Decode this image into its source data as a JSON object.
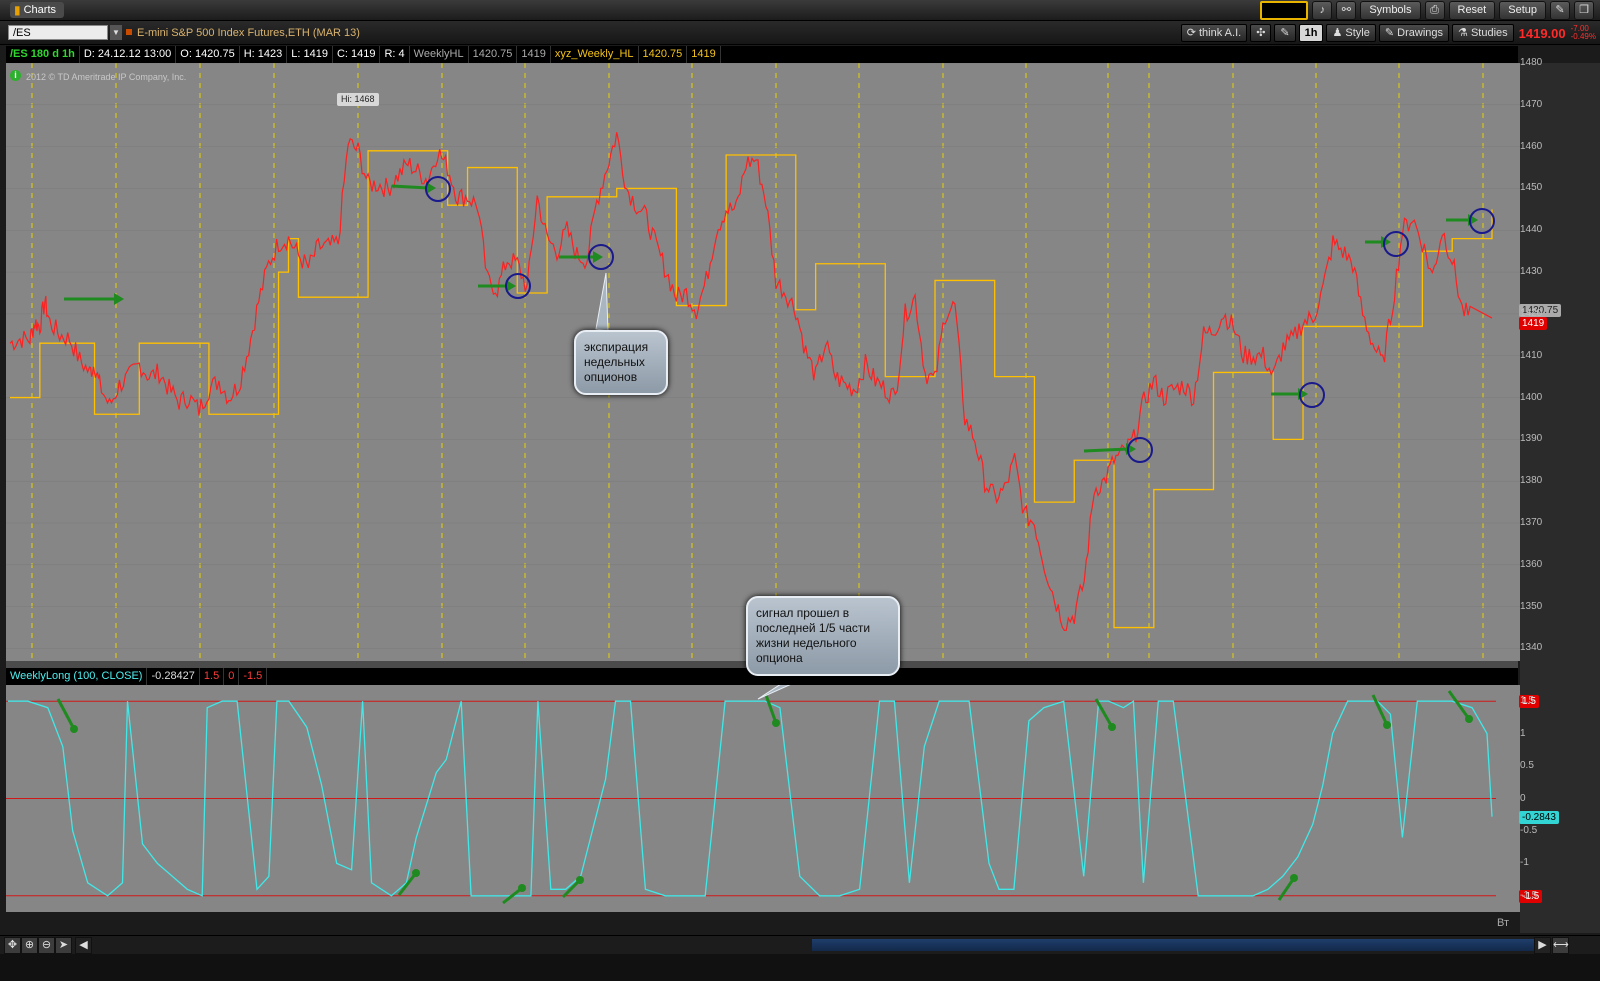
{
  "app": {
    "tab_label": "Charts"
  },
  "topbar": {
    "symbols": "Symbols",
    "reset": "Reset",
    "setup": "Setup"
  },
  "toolbar": {
    "symbol": "/ES",
    "description": "E-mini S&P 500 Index Futures,ETH (MAR 13)",
    "think": "think A.I.",
    "interval": "1h",
    "style": "Style",
    "drawings": "Drawings",
    "studies": "Studies",
    "last_price": "1419.00",
    "chg_abs": "-7.00",
    "chg_pct": "-0.49%"
  },
  "info_bar": {
    "sym": "/ES 180 d 1h",
    "date": "D: 24.12.12 13:00",
    "open": "O: 1420.75",
    "high": "H: 1423",
    "low": "L: 1419",
    "close": "C: 1419",
    "range": "R: 4",
    "study1": "WeeklyHL",
    "study1_v1": "1420.75",
    "study1_v2": "1419",
    "study2": "xyz_Weekly_HL",
    "study2_v1": "1420.75",
    "study2_v2": "1419"
  },
  "copyright": "2012 © TD Ameritrade IP Company, Inc.",
  "hi_label": "Hi: 1468",
  "price_axis": {
    "ticks": [
      "1480",
      "1470",
      "1460",
      "1450",
      "1440",
      "1430",
      "1420",
      "1410",
      "1400",
      "1390",
      "1380",
      "1370",
      "1360",
      "1350",
      "1340"
    ],
    "tag_gray": "1420.75",
    "tag_red": "1419"
  },
  "lower": {
    "study": "WeeklyLong (100, CLOSE)",
    "value": "-0.28427",
    "p1": "1.5",
    "p2": "0",
    "p3": "-1.5",
    "ticks": [
      "1.5",
      "1",
      "0.5",
      "0",
      "-0.5",
      "-1",
      "-1.5"
    ],
    "tag_cur": "-0.2843"
  },
  "annotations": {
    "expiry": "экспирация недельных опционов",
    "signal": "сигнал прошел в последней 1/5 части жизни недельного опциона"
  },
  "day_label": "Вт",
  "colors": {
    "price": "#ff2020",
    "weekly": "#ffc000",
    "osc": "#40e8e8",
    "arrow": "#1f8a1f",
    "circle": "#1a1a8c"
  },
  "chart_data": {
    "type": "line",
    "title": "",
    "xlabel": "",
    "ylabel": "",
    "ylim": [
      1337,
      1480
    ],
    "x": [
      0,
      10,
      20,
      25,
      30,
      35,
      40,
      50,
      60,
      70,
      80,
      85,
      90,
      100,
      110,
      120,
      130,
      140,
      150,
      160,
      170,
      180,
      190,
      200,
      210,
      220,
      230,
      240,
      250,
      260,
      270,
      280,
      290,
      300,
      310,
      320,
      330,
      340,
      350,
      360,
      370,
      380,
      390,
      400,
      410,
      420,
      430,
      440,
      450,
      460,
      470,
      480,
      490,
      500,
      510,
      520,
      530,
      540,
      550,
      560,
      570,
      580,
      590,
      600,
      610,
      620,
      630,
      640,
      650,
      660,
      670,
      680,
      690,
      700,
      710,
      720,
      730,
      740,
      750,
      760,
      770,
      780,
      790,
      800,
      810,
      820,
      830,
      840,
      850,
      860,
      870,
      880,
      890,
      900,
      910,
      920,
      930,
      940,
      950,
      960,
      970,
      980,
      990,
      1000,
      1010,
      1020,
      1030,
      1040,
      1050,
      1060,
      1070,
      1080,
      1090,
      1100,
      1110,
      1120,
      1130,
      1140,
      1150,
      1160,
      1170,
      1180,
      1190,
      1200,
      1210,
      1220,
      1230,
      1240,
      1250,
      1260,
      1270,
      1280,
      1290,
      1300,
      1310,
      1320,
      1330,
      1340,
      1350,
      1360,
      1370,
      1380,
      1390,
      1400,
      1410,
      1420,
      1430,
      1440,
      1450,
      1460,
      1470,
      1480,
      1490
    ],
    "series": [
      {
        "values": [
          1413,
          1414,
          1414,
          1418,
          1417,
          1423,
          1418,
          1415,
          1414,
          1409,
          1406,
          1408,
          1403,
          1398,
          1403,
          1405,
          1408,
          1405,
          1406,
          1402,
          1399,
          1400,
          1397,
          1402,
          1404,
          1400,
          1403,
          1412,
          1423,
          1432,
          1437,
          1438,
          1434,
          1431,
          1436,
          1436,
          1437,
          1461,
          1459,
          1451,
          1451,
          1450,
          1453,
          1456,
          1454,
          1452,
          1459,
          1455,
          1448,
          1448,
          1446,
          1428,
          1426,
          1433,
          1432,
          1426,
          1448,
          1438,
          1435,
          1440,
          1434,
          1433,
          1447,
          1455,
          1463,
          1450,
          1446,
          1443,
          1436,
          1430,
          1424,
          1425,
          1421,
          1428,
          1440,
          1445,
          1445,
          1456,
          1457,
          1447,
          1428,
          1425,
          1421,
          1411,
          1405,
          1413,
          1405,
          1403,
          1402,
          1408,
          1404,
          1402,
          1400,
          1420,
          1424,
          1406,
          1404,
          1420,
          1422,
          1395,
          1390,
          1380,
          1376,
          1378,
          1385,
          1372,
          1370,
          1360,
          1352,
          1346,
          1348,
          1356,
          1378,
          1380,
          1385,
          1387,
          1390,
          1399,
          1404,
          1400,
          1402,
          1403,
          1400,
          1415,
          1416,
          1420,
          1417,
          1410,
          1410,
          1410,
          1405,
          1412,
          1414,
          1418,
          1419,
          1426,
          1437,
          1435,
          1432,
          1420,
          1413,
          1408,
          1422,
          1440,
          1443,
          1437,
          1429,
          1440,
          1433,
          1421,
          1419
        ]
      },
      {
        "values": [
          1400,
          1400,
          1400,
          1400,
          1413,
          1413,
          1413,
          1413,
          1413,
          1413,
          1413,
          1396,
          1396,
          1396,
          1396,
          1396,
          1413,
          1413,
          1413,
          1413,
          1413,
          1413,
          1413,
          1396,
          1396,
          1396,
          1396,
          1396,
          1396,
          1396,
          1430,
          1438,
          1424,
          1424,
          1424,
          1424,
          1424,
          1424,
          1424,
          1459,
          1459,
          1459,
          1459,
          1459,
          1459,
          1459,
          1459,
          1446,
          1446,
          1455,
          1455,
          1455,
          1455,
          1455,
          1425,
          1425,
          1425,
          1448,
          1448,
          1448,
          1448,
          1448,
          1448,
          1448,
          1450,
          1450,
          1450,
          1450,
          1450,
          1450,
          1422,
          1422,
          1422,
          1422,
          1422,
          1458,
          1458,
          1458,
          1458,
          1458,
          1458,
          1458,
          1421,
          1421,
          1432,
          1432,
          1432,
          1432,
          1432,
          1432,
          1432,
          1405,
          1405,
          1405,
          1405,
          1405,
          1428,
          1428,
          1428,
          1428,
          1428,
          1428,
          1405,
          1405,
          1405,
          1405,
          1375,
          1375,
          1375,
          1375,
          1385,
          1385,
          1385,
          1385,
          1345,
          1345,
          1345,
          1345,
          1378,
          1378,
          1378,
          1378,
          1378,
          1378,
          1406,
          1406,
          1406,
          1406,
          1406,
          1406,
          1390,
          1390,
          1390,
          1417,
          1417,
          1417,
          1417,
          1417,
          1417,
          1417,
          1417,
          1417,
          1417,
          1417,
          1417,
          1435,
          1435,
          1435,
          1438,
          1438,
          1438,
          1438,
          1445,
          1445,
          1445
        ]
      }
    ],
    "osc": {
      "ylim": [
        -1.75,
        1.75
      ],
      "x": [
        0,
        20,
        40,
        55,
        65,
        80,
        100,
        115,
        120,
        135,
        150,
        165,
        180,
        195,
        200,
        215,
        230,
        250,
        262,
        270,
        282,
        300,
        315,
        330,
        345,
        356,
        365,
        385,
        400,
        410,
        420,
        430,
        440,
        455,
        465,
        475,
        490,
        510,
        525,
        532,
        545,
        560,
        575,
        600,
        610,
        625,
        640,
        660,
        680,
        700,
        720,
        740,
        760,
        775,
        795,
        815,
        835,
        855,
        875,
        890,
        905,
        920,
        935,
        950,
        965,
        985,
        995,
        1010,
        1025,
        1040,
        1060,
        1080,
        1095,
        1105,
        1120,
        1130,
        1140,
        1155,
        1170,
        1195,
        1215,
        1235,
        1250,
        1265,
        1280,
        1295,
        1310,
        1320,
        1330,
        1345,
        1360,
        1375,
        1388,
        1400,
        1415,
        1430,
        1450,
        1470,
        1485,
        1490
      ],
      "values": [
        1.5,
        1.5,
        1.4,
        0.8,
        -0.5,
        -1.3,
        -1.5,
        -1.3,
        1.5,
        -0.7,
        -1.0,
        -1.2,
        -1.4,
        -1.5,
        1.4,
        1.5,
        1.5,
        -1.4,
        -1.2,
        1.5,
        1.5,
        1.1,
        0.2,
        -1.0,
        -1.1,
        1.5,
        -1.3,
        -1.5,
        -1.3,
        -0.6,
        -0.1,
        0.4,
        0.6,
        1.5,
        -1.5,
        -1.5,
        -1.5,
        -1.5,
        -1.5,
        1.5,
        -1.4,
        -1.4,
        -1.2,
        0.3,
        1.5,
        1.5,
        -1.4,
        -1.5,
        -1.5,
        -1.5,
        1.5,
        1.5,
        1.5,
        1.4,
        -1.2,
        -1.5,
        -1.5,
        -1.4,
        1.5,
        1.5,
        -1.3,
        0.8,
        1.5,
        1.5,
        1.5,
        -1.0,
        -1.4,
        -1.4,
        1.2,
        1.4,
        1.5,
        -1.2,
        1.5,
        1.5,
        1.4,
        1.5,
        -1.3,
        1.5,
        1.5,
        -1.5,
        -1.5,
        -1.5,
        -1.5,
        -1.4,
        -1.2,
        -0.9,
        -0.4,
        0.2,
        1.0,
        1.5,
        1.5,
        1.5,
        1.3,
        -0.6,
        1.5,
        1.5,
        1.5,
        1.4,
        1.0,
        -0.28
      ]
    }
  }
}
